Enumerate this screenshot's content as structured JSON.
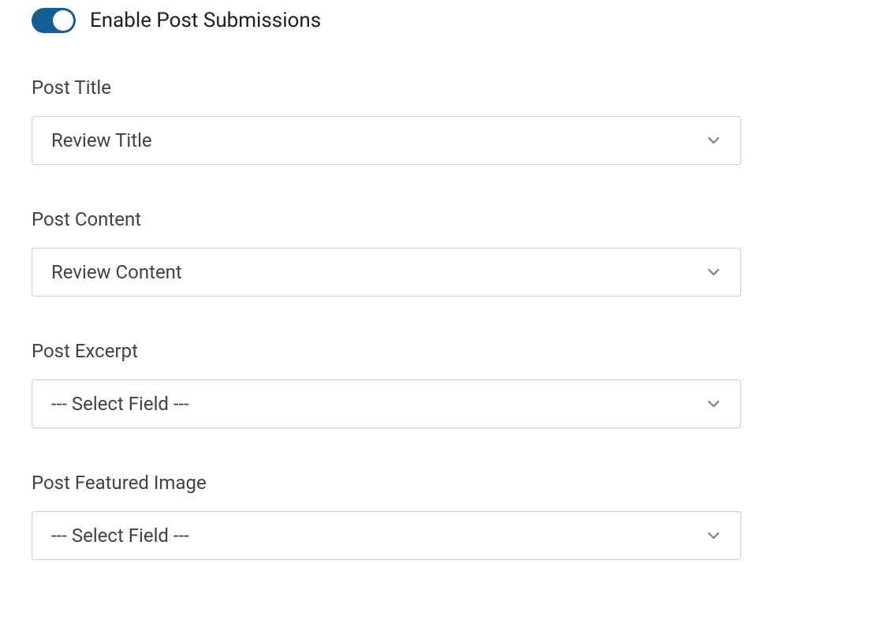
{
  "toggle": {
    "label": "Enable Post Submissions",
    "enabled": true
  },
  "fields": {
    "post_title": {
      "label": "Post Title",
      "value": "Review Title"
    },
    "post_content": {
      "label": "Post Content",
      "value": "Review Content"
    },
    "post_excerpt": {
      "label": "Post Excerpt",
      "value": "--- Select Field ---"
    },
    "post_featured_image": {
      "label": "Post Featured Image",
      "value": "--- Select Field ---"
    }
  }
}
